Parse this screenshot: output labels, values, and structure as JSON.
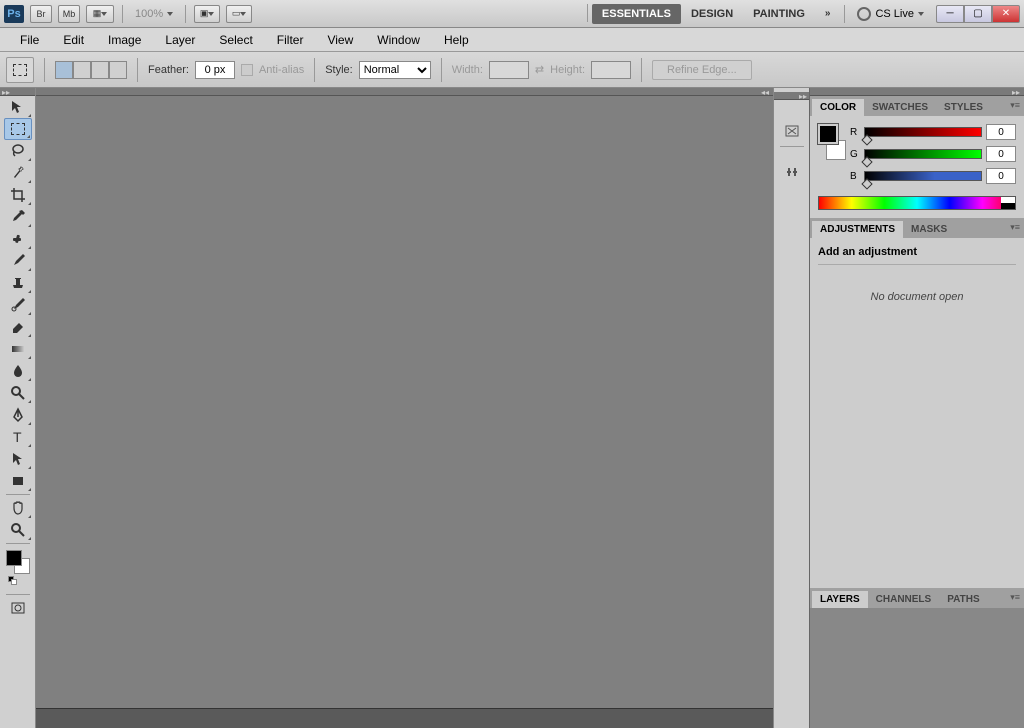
{
  "app": {
    "logo": "Ps"
  },
  "appbar": {
    "br_label": "Br",
    "mb_label": "Mb",
    "zoom": "100%",
    "workspaces": [
      "ESSENTIALS",
      "DESIGN",
      "PAINTING"
    ],
    "active_workspace": 0,
    "cslive": "CS Live"
  },
  "menu": [
    "File",
    "Edit",
    "Image",
    "Layer",
    "Select",
    "Filter",
    "View",
    "Window",
    "Help"
  ],
  "options": {
    "feather_label": "Feather:",
    "feather_value": "0 px",
    "antialias_label": "Anti-alias",
    "style_label": "Style:",
    "style_value": "Normal",
    "width_label": "Width:",
    "height_label": "Height:",
    "refine_label": "Refine Edge..."
  },
  "panels": {
    "color": {
      "tabs": [
        "COLOR",
        "SWATCHES",
        "STYLES"
      ],
      "r_label": "R",
      "g_label": "G",
      "b_label": "B",
      "r": "0",
      "g": "0",
      "b": "0"
    },
    "adjustments": {
      "tabs": [
        "ADJUSTMENTS",
        "MASKS"
      ],
      "title": "Add an adjustment",
      "empty": "No document open"
    },
    "layers": {
      "tabs": [
        "LAYERS",
        "CHANNELS",
        "PATHS"
      ]
    }
  }
}
